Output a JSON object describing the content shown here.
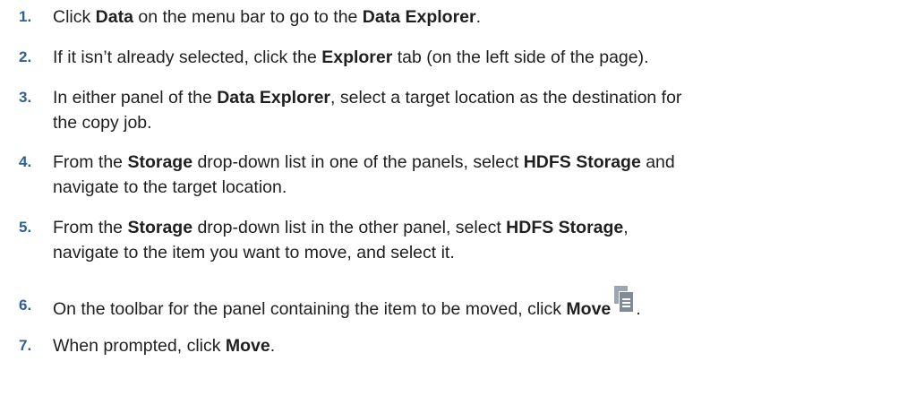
{
  "steps": [
    {
      "num": "1.",
      "parts": [
        {
          "t": "Click "
        },
        {
          "t": "Data",
          "b": true
        },
        {
          "t": " on the menu bar to go to the "
        },
        {
          "t": "Data Explorer",
          "b": true
        },
        {
          "t": "."
        }
      ]
    },
    {
      "num": "2.",
      "parts": [
        {
          "t": "If it isn’t already selected, click the "
        },
        {
          "t": "Explorer",
          "b": true
        },
        {
          "t": " tab (on the left side of the page)."
        }
      ]
    },
    {
      "num": "3.",
      "parts": [
        {
          "t": "In either panel of the "
        },
        {
          "t": "Data Explorer",
          "b": true
        },
        {
          "t": ", select a target location as the destination for"
        },
        {
          "br": true
        },
        {
          "t": "the copy job."
        }
      ]
    },
    {
      "num": "4.",
      "parts": [
        {
          "t": "From the "
        },
        {
          "t": "Storage",
          "b": true
        },
        {
          "t": " drop-down list in one of the panels, select "
        },
        {
          "t": "HDFS Storage",
          "b": true
        },
        {
          "t": " and"
        },
        {
          "br": true
        },
        {
          "t": "navigate to the target location."
        }
      ]
    },
    {
      "num": "5.",
      "parts": [
        {
          "t": "From the "
        },
        {
          "t": "Storage",
          "b": true
        },
        {
          "t": " drop-down list in the other panel, select "
        },
        {
          "t": "HDFS Storage",
          "b": true
        },
        {
          "t": ","
        },
        {
          "br": true
        },
        {
          "t": "navigate to the item you want to move, and select it."
        }
      ]
    },
    {
      "num": "6.",
      "parts": [
        {
          "t": "On the toolbar for the panel containing the item to be moved, click "
        },
        {
          "t": "Move",
          "b": true
        },
        {
          "icon": "move-icon"
        },
        {
          "t": "."
        }
      ]
    },
    {
      "num": "7.",
      "parts": [
        {
          "t": "When prompted, click "
        },
        {
          "t": "Move",
          "b": true
        },
        {
          "t": "."
        }
      ]
    }
  ],
  "colors": {
    "step_number": "#2f5f9a",
    "body_text": "#1f1f1f",
    "icon_back": "#9aa6b2",
    "icon_front": "#7f8b97"
  }
}
